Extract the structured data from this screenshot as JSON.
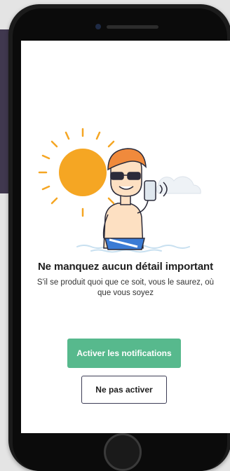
{
  "onboarding": {
    "title": "Ne manquez aucun détail important",
    "subtitle": "S'il se produit quoi que ce soit, vous le saurez, où que vous soyez",
    "primary_button": "Activer les notifications",
    "secondary_button": "Ne pas activer"
  },
  "colors": {
    "primary": "#57b98d",
    "secondary_border": "#3d3d56",
    "phone": "#1b1b1b",
    "accent_card": "#40384f"
  },
  "icons": [
    "sun-icon",
    "cloud-icon",
    "beach-person-illustration",
    "smartphone-icon"
  ]
}
